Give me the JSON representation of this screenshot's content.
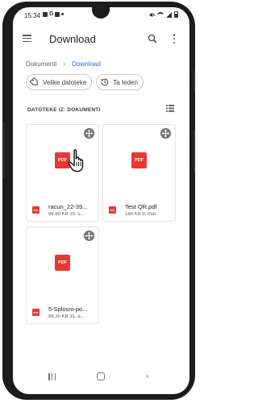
{
  "status_bar": {
    "time": "15:34",
    "icons_left": [
      "notification-icon",
      "g-icon",
      "notification-icon",
      "dot-icon"
    ],
    "icons_right": [
      "mute-icon",
      "wifi-icon",
      "signal-icon",
      "battery-icon"
    ]
  },
  "app_bar": {
    "title": "Download",
    "icons": [
      "menu-icon",
      "search-icon",
      "more-vert-icon"
    ]
  },
  "breadcrumb": {
    "items": [
      "Dokumenti",
      "Download"
    ],
    "separator": "›"
  },
  "chips": [
    {
      "label": "Velike datoteke",
      "icon": "label-icon"
    },
    {
      "label": "Ta teden",
      "icon": "history-icon"
    }
  ],
  "section": {
    "title": "DATOTEKE IZ: DOKUMENTI",
    "view_icon": "list-view-icon"
  },
  "files": [
    {
      "name": "racun_22-39...",
      "meta": "96,89 KB 30. s...",
      "badge": "PDF"
    },
    {
      "name": "Test QR.pdf",
      "meta": "186 KB 9. mar.",
      "badge": "PDF"
    },
    {
      "name": "5-Splosni-po...",
      "meta": "88,35 KB 31. a...",
      "badge": "PDF"
    }
  ],
  "colors": {
    "accent": "#1a73e8",
    "pdf_red": "#e53935",
    "phone_frame": "#1c1c1c"
  },
  "nav_bar": {
    "icons": [
      "recent-apps-icon",
      "home-icon",
      "back-icon"
    ],
    "back_glyph": "‹"
  }
}
